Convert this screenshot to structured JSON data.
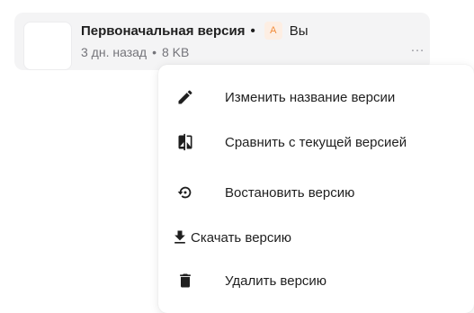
{
  "version": {
    "title": "Первоначальная версия",
    "separator": "•",
    "author_initial": "А",
    "author_name": "Вы",
    "time": "3 дн. назад",
    "meta_separator": "•",
    "size": "8 KB",
    "more_label": "…"
  },
  "menu": {
    "items": [
      {
        "label": "Изменить название версии",
        "icon": "pencil-icon"
      },
      {
        "label": "Сравнить с текущей версией",
        "icon": "compare-icon"
      },
      {
        "label": "Востановить версию",
        "icon": "restore-icon"
      },
      {
        "label": "Скачать версию",
        "icon": "download-icon"
      },
      {
        "label": "Удалить версию",
        "icon": "trash-icon"
      }
    ]
  },
  "colors": {
    "badge_bg": "#fdeee3",
    "badge_fg": "#f28c3a",
    "icon": "#1f1f1f"
  }
}
